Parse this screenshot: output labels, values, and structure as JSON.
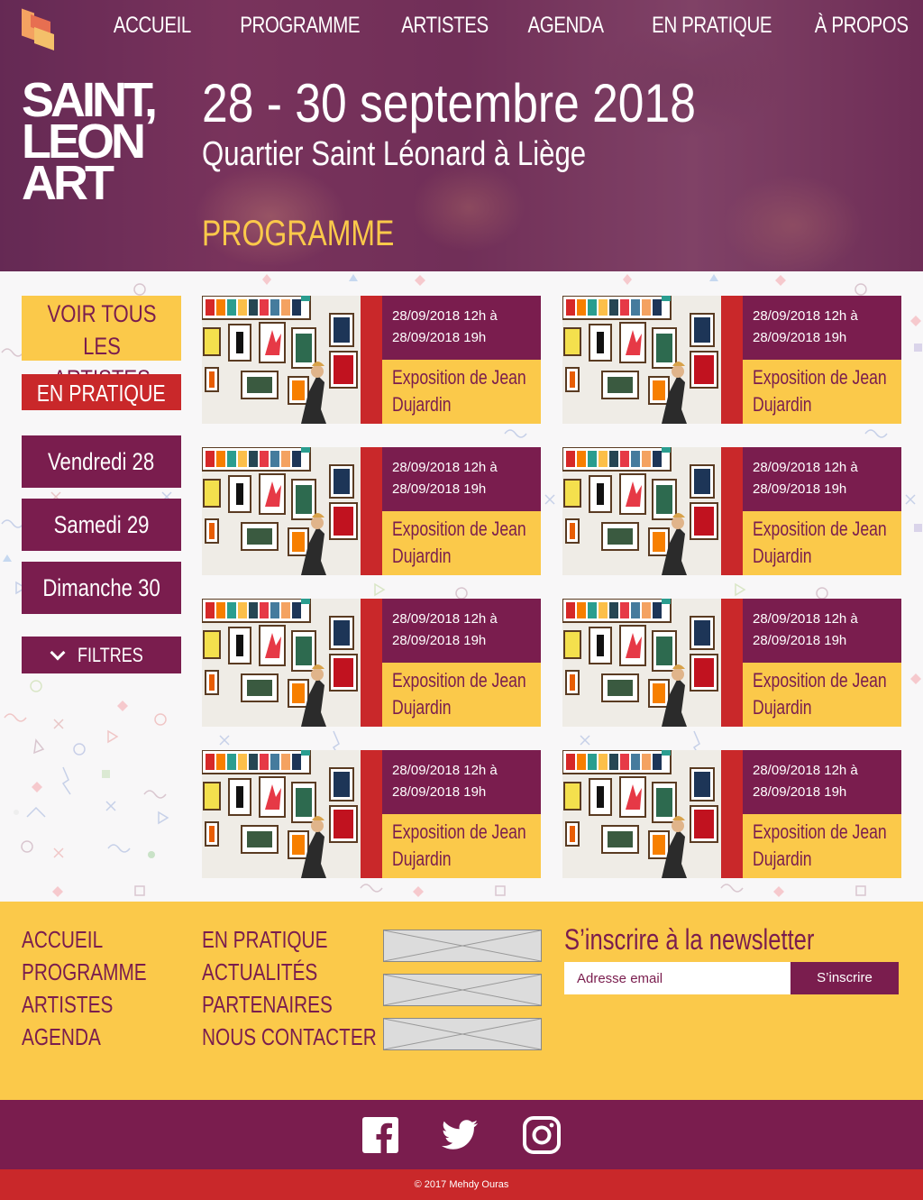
{
  "nav": {
    "items": [
      {
        "label": "ACCUEIL"
      },
      {
        "label": "PROGRAMME"
      },
      {
        "label": "ARTISTES"
      },
      {
        "label": "AGENDA"
      },
      {
        "label": "EN PRATIQUE"
      },
      {
        "label": "À PROPOS"
      }
    ]
  },
  "logo": {
    "lines": [
      "SAINT,",
      "LEON",
      "ART"
    ]
  },
  "hero": {
    "date": "28 - 30 septembre 2018",
    "place": "Quartier Saint Léonard à Liège",
    "section": "PROGRAMME"
  },
  "sidebar": {
    "artistes_label": "VOIR TOUS LES ARTISTES",
    "pratique_label": "EN PRATIQUE",
    "days": [
      {
        "label": "Vendredi 28"
      },
      {
        "label": "Samedi 29"
      },
      {
        "label": "Dimanche 30"
      }
    ],
    "filter_label": "FILTRES"
  },
  "events": [
    {
      "date_line1": "28/09/2018 12h à",
      "date_line2": "28/09/2018 19h",
      "title_line1": "Exposition de Jean",
      "title_line2": "Dujardin"
    },
    {
      "date_line1": "28/09/2018 12h à",
      "date_line2": "28/09/2018 19h",
      "title_line1": "Exposition de Jean",
      "title_line2": "Dujardin"
    },
    {
      "date_line1": "28/09/2018 12h à",
      "date_line2": "28/09/2018 19h",
      "title_line1": "Exposition de Jean",
      "title_line2": "Dujardin"
    },
    {
      "date_line1": "28/09/2018 12h à",
      "date_line2": "28/09/2018 19h",
      "title_line1": "Exposition de Jean",
      "title_line2": "Dujardin"
    },
    {
      "date_line1": "28/09/2018 12h à",
      "date_line2": "28/09/2018 19h",
      "title_line1": "Exposition de Jean",
      "title_line2": "Dujardin"
    },
    {
      "date_line1": "28/09/2018 12h à",
      "date_line2": "28/09/2018 19h",
      "title_line1": "Exposition de Jean",
      "title_line2": "Dujardin"
    },
    {
      "date_line1": "28/09/2018 12h à",
      "date_line2": "28/09/2018 19h",
      "title_line1": "Exposition de Jean",
      "title_line2": "Dujardin"
    },
    {
      "date_line1": "28/09/2018 12h à",
      "date_line2": "28/09/2018 19h",
      "title_line1": "Exposition de Jean",
      "title_line2": "Dujardin"
    }
  ],
  "footer": {
    "col1": [
      {
        "label": "ACCUEIL"
      },
      {
        "label": "PROGRAMME"
      },
      {
        "label": "ARTISTES"
      },
      {
        "label": "AGENDA"
      }
    ],
    "col2": [
      {
        "label": "EN PRATIQUE"
      },
      {
        "label": "ACTUALITÉS"
      },
      {
        "label": "PARTENAIRES"
      },
      {
        "label": "NOUS CONTACTER"
      }
    ],
    "newsletter_title": "S’inscrire à la newsletter",
    "email_placeholder": "Adresse email",
    "subscribe_label": "S’inscrire",
    "social": [
      "facebook-icon",
      "twitter-icon",
      "instagram-icon"
    ],
    "copyright": "© 2017 Mehdy Ouras"
  },
  "colors": {
    "purple": "#7a1d4e",
    "yellow": "#fbc94a",
    "red": "#c9282a"
  }
}
